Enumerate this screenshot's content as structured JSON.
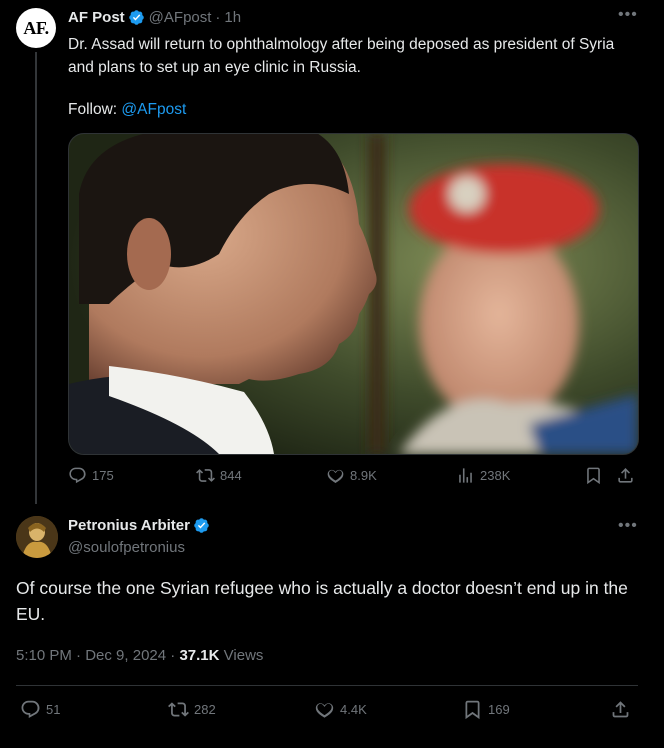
{
  "quoted": {
    "avatar_text": "AF.",
    "name": "AF Post",
    "handle": "@AFpost",
    "time": "1h",
    "text": "Dr. Assad will return to ophthalmology after being deposed as president of Syria and plans to set up an eye clinic in Russia.",
    "follow_label": "Follow:",
    "follow_link": "@AFpost",
    "stats": {
      "replies": "175",
      "reposts": "844",
      "likes": "8.9K",
      "views": "238K"
    }
  },
  "main": {
    "name": "Petronius Arbiter",
    "handle": "@soulofpetronius",
    "text": "Of course the one Syrian refugee who is actually a doctor doesn’t end up in the EU.",
    "time": "5:10 PM",
    "date": "Dec 9, 2024",
    "views_count": "37.1K",
    "views_label": "Views",
    "stats": {
      "replies": "51",
      "reposts": "282",
      "likes": "4.4K",
      "bookmarks": "169"
    }
  },
  "separators": {
    "dot": "·"
  },
  "icons": {
    "verified": "verified-badge-icon",
    "reply": "reply-icon",
    "repost": "repost-icon",
    "like": "like-icon",
    "views": "views-icon",
    "bookmark": "bookmark-icon",
    "share": "share-icon",
    "more": "more-icon"
  },
  "colors": {
    "background": "#000000",
    "text": "#e7e9ea",
    "muted": "#71767b",
    "accent": "#1d9bf0",
    "divider": "#2f3336"
  }
}
